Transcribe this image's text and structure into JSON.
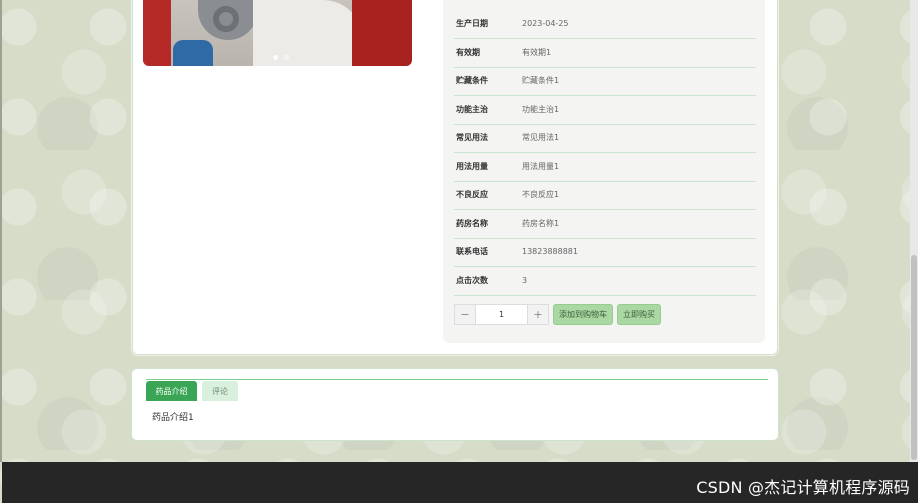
{
  "product_info": {
    "rows": [
      {
        "label": "生产日期",
        "value": "2023-04-25"
      },
      {
        "label": "有效期",
        "value": "有效期1"
      },
      {
        "label": "贮藏条件",
        "value": "贮藏条件1"
      },
      {
        "label": "功能主治",
        "value": "功能主治1"
      },
      {
        "label": "常见用法",
        "value": "常见用法1"
      },
      {
        "label": "用法用量",
        "value": "用法用量1"
      },
      {
        "label": "不良反应",
        "value": "不良反应1"
      },
      {
        "label": "药房名称",
        "value": "药房名称1"
      },
      {
        "label": "联系电话",
        "value": "13823888881"
      },
      {
        "label": "点击次数",
        "value": "3"
      }
    ]
  },
  "quantity": {
    "minus": "−",
    "value": "1",
    "plus": "+"
  },
  "actions": {
    "add_to_cart": "添加到购物车",
    "buy_now": "立即购买"
  },
  "tabs": [
    {
      "label": "药品介绍",
      "active": true
    },
    {
      "label": "评论",
      "active": false
    }
  ],
  "tab_content": "药品介绍1",
  "watermark": "CSDN @杰记计算机程序源码",
  "colors": {
    "accent": "#3aa655",
    "button": "#a9d8a3",
    "footer": "#262626"
  }
}
